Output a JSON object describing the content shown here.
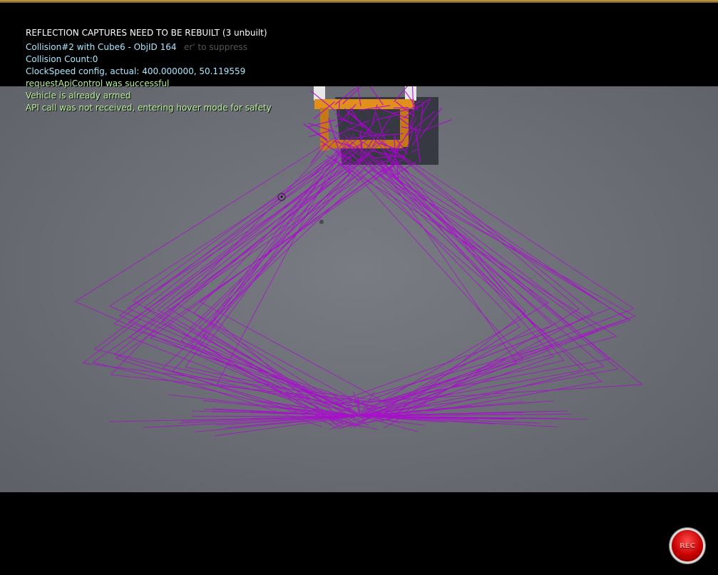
{
  "hud": {
    "warning": "REFLECTION CAPTURES NEED TO BE REBUILT (3 unbuilt)",
    "ghost_text": "er' to suppress",
    "messages": [
      "Collision#2 with Cube6 - ObjID 164",
      "Collision Count:0",
      "ClockSpeed config, actual: 400.000000, 50.119559",
      "requestApiControl was successful",
      "Vehicle is already armed",
      "API call was not received, entering hover mode for safety"
    ]
  },
  "record": {
    "label": "REC"
  },
  "colors": {
    "trace": "#b000d8",
    "frame": "#e2901c",
    "floor": "#6e7078",
    "message_cyan": "#a9e7ff",
    "message_green": "#b8f29a",
    "rec": "#c80000"
  }
}
